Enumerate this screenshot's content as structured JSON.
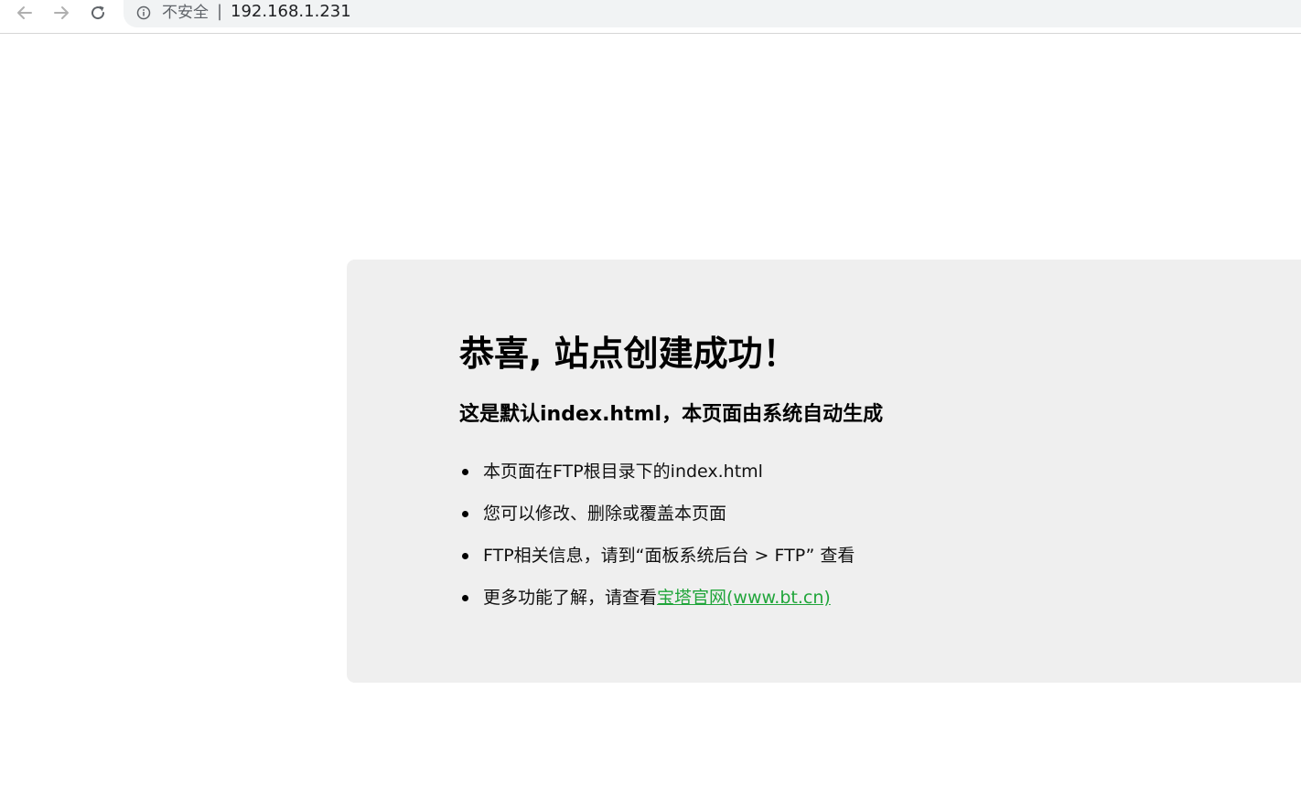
{
  "browser": {
    "security_label": "不安全",
    "separator": "|",
    "url": "192.168.1.231",
    "icons": {
      "back": "arrow-left-icon",
      "forward": "arrow-right-icon",
      "reload": "reload-icon",
      "site_info": "info-circle-icon"
    }
  },
  "page": {
    "heading": "恭喜, 站点创建成功！",
    "subheading": "这是默认index.html，本页面由系统自动生成",
    "items": [
      {
        "text": "本页面在FTP根目录下的index.html"
      },
      {
        "text": "您可以修改、删除或覆盖本页面"
      },
      {
        "text": "FTP相关信息，请到“面板系统后台 > FTP” 查看"
      },
      {
        "text": "更多功能了解，请查看",
        "link_text": "宝塔官网(www.bt.cn)"
      }
    ],
    "colors": {
      "card_background": "#efefef",
      "link": "#20a53a"
    }
  }
}
